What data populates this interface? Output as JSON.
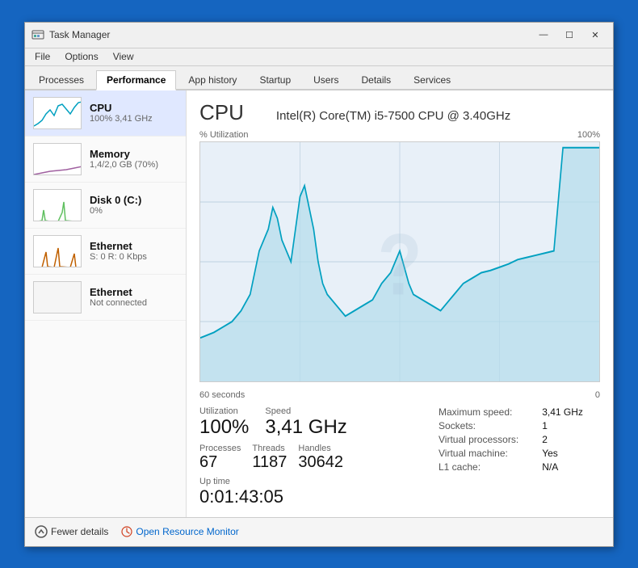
{
  "window": {
    "title": "Task Manager",
    "icon": "⚙"
  },
  "titlebar": {
    "minimize": "—",
    "maximize": "☐",
    "close": "✕"
  },
  "menubar": {
    "items": [
      "File",
      "Options",
      "View"
    ]
  },
  "tabs": {
    "items": [
      "Processes",
      "Performance",
      "App history",
      "Startup",
      "Users",
      "Details",
      "Services"
    ],
    "active": "Performance"
  },
  "sidebar": {
    "items": [
      {
        "label": "CPU",
        "sublabel": "100% 3,41 GHz",
        "type": "cpu"
      },
      {
        "label": "Memory",
        "sublabel": "1,4/2,0 GB (70%)",
        "type": "memory"
      },
      {
        "label": "Disk 0 (C:)",
        "sublabel": "0%",
        "type": "disk"
      },
      {
        "label": "Ethernet",
        "sublabel": "S: 0  R: 0 Kbps",
        "type": "ethernet1"
      },
      {
        "label": "Ethernet",
        "sublabel": "Not connected",
        "type": "ethernet2"
      }
    ]
  },
  "main": {
    "cpu_title": "CPU",
    "cpu_model": "Intel(R) Core(TM) i5-7500 CPU @ 3.40GHz",
    "chart": {
      "y_label": "% Utilization",
      "y_max": "100%",
      "x_min": "60 seconds",
      "x_max": "0"
    },
    "stats": {
      "utilization_label": "Utilization",
      "utilization_value": "100%",
      "speed_label": "Speed",
      "speed_value": "3,41 GHz",
      "processes_label": "Processes",
      "processes_value": "67",
      "threads_label": "Threads",
      "threads_value": "1187",
      "handles_label": "Handles",
      "handles_value": "30642",
      "uptime_label": "Up time",
      "uptime_value": "0:01:43:05"
    },
    "right_stats": {
      "max_speed_label": "Maximum speed:",
      "max_speed_value": "3,41 GHz",
      "sockets_label": "Sockets:",
      "sockets_value": "1",
      "virtual_proc_label": "Virtual processors:",
      "virtual_proc_value": "2",
      "virtual_machine_label": "Virtual machine:",
      "virtual_machine_value": "Yes",
      "l1_cache_label": "L1 cache:",
      "l1_cache_value": "N/A"
    }
  },
  "footer": {
    "fewer_details": "Fewer details",
    "open_monitor": "Open Resource Monitor"
  },
  "colors": {
    "cpu_line": "#00a0c0",
    "cpu_fill": "#cce8f0",
    "memory_line": "#a060a0",
    "disk_line": "#60c060",
    "ethernet_line": "#c06000"
  }
}
